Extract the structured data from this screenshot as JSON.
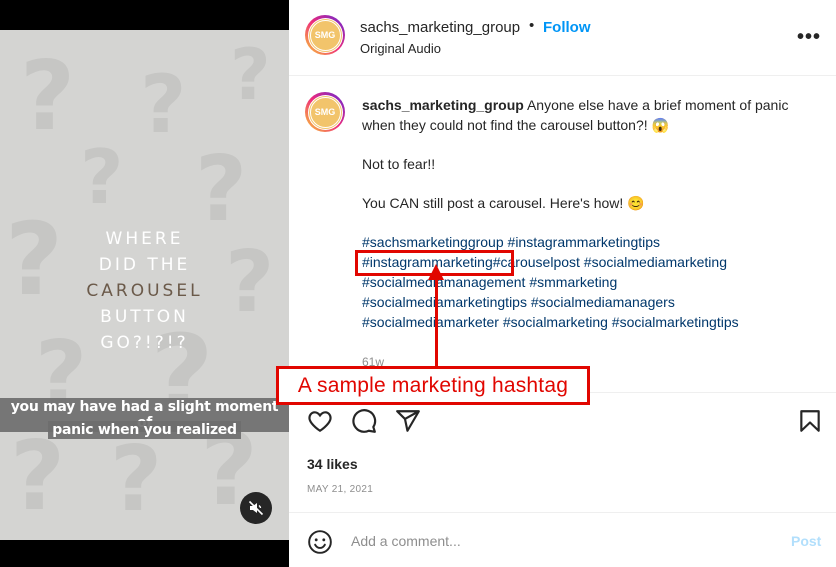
{
  "media": {
    "title_lines": [
      "WHERE",
      "DID THE",
      "CAROUSEL",
      "BUTTON",
      "GO?!?!?"
    ],
    "caption_lines": [
      "you may have had a slight moment of",
      "panic when you realized"
    ],
    "mute_icon": "speaker-muted-icon",
    "background_color": "#d4d4d2"
  },
  "header": {
    "avatar_text": "SMG",
    "username": "sachs_marketing_group",
    "separator": "•",
    "follow_label": "Follow",
    "audio_label": "Original Audio",
    "more_icon": "more-options-icon"
  },
  "comment": {
    "avatar_text": "SMG",
    "username": "sachs_marketing_group",
    "text": " Anyone else have a brief moment of panic when they could not find the carousel button?! 😱",
    "para2": "Not to fear!!",
    "para3": "You CAN still post a carousel. Here's how! 😊",
    "hashtags": [
      "#sachsmarketinggroup",
      "#instagrammarketingtips",
      "#instagrammarketing",
      "#carouselpost",
      "#socialmediamarketing",
      "#socialmediamanagement",
      "#smmarketing",
      "#socialmediamarketingtips",
      "#socialmediamanagers",
      "#socialmediamarketer",
      "#socialmarketing",
      "#socialmarketingtips"
    ],
    "time": "61w"
  },
  "actions": {
    "like_icon": "heart-icon",
    "comment_icon": "comment-icon",
    "share_icon": "share-icon",
    "save_icon": "bookmark-icon"
  },
  "likes": "34 likes",
  "date": "MAY 21, 2021",
  "add_comment": {
    "emoji_icon": "emoji-icon",
    "placeholder": "Add a comment...",
    "post_label": "Post"
  },
  "annotation": {
    "label": "A sample marketing hashtag",
    "color": "#e10600"
  },
  "colors": {
    "link_blue": "#0095f6",
    "hashtag": "#00376b",
    "muted": "#8e8e8e"
  }
}
